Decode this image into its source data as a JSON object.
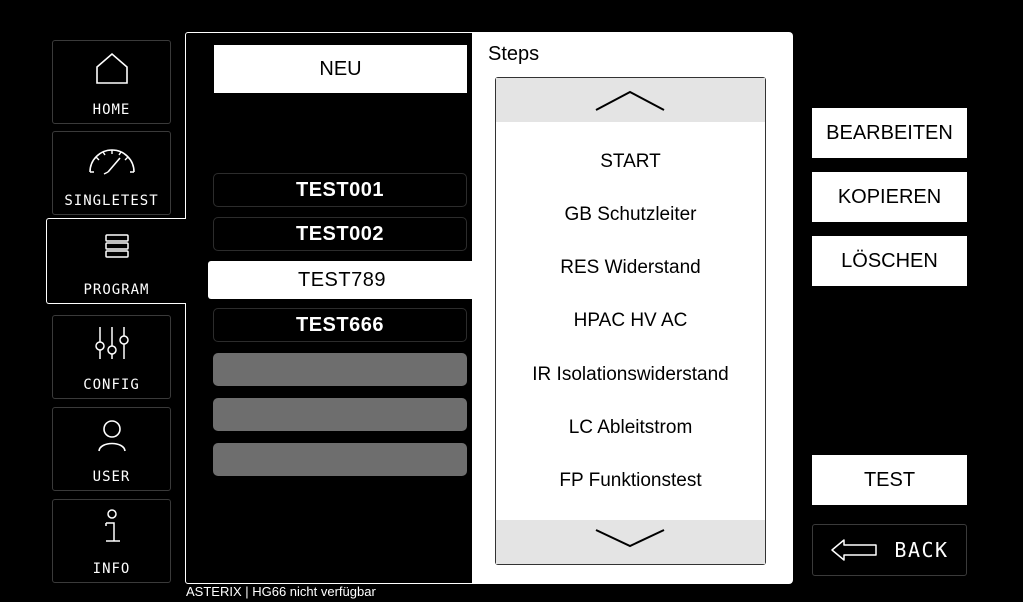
{
  "sidebar": {
    "items": [
      {
        "label": "HOME",
        "icon": "home-icon"
      },
      {
        "label": "SINGLETEST",
        "icon": "gauge-icon"
      },
      {
        "label": "PROGRAM",
        "icon": "stack-icon"
      },
      {
        "label": "CONFIG",
        "icon": "sliders-icon"
      },
      {
        "label": "USER",
        "icon": "user-icon"
      },
      {
        "label": "INFO",
        "icon": "info-icon"
      }
    ],
    "active": "PROGRAM"
  },
  "programs": {
    "new_label": "NEU",
    "items": [
      "TEST001",
      "TEST002",
      "TEST789",
      "TEST666",
      "",
      "",
      ""
    ],
    "selected": "TEST789"
  },
  "steps": {
    "title": "Steps",
    "items": [
      "START",
      "GB Schutzleiter",
      "RES Widerstand",
      "HPAC HV AC",
      "IR Isolationswiderstand",
      "LC Ableitstrom",
      "FP Funktionstest"
    ]
  },
  "actions": {
    "edit": "BEARBEITEN",
    "copy": "KOPIEREN",
    "delete": "LÖSCHEN",
    "test": "TEST",
    "back": "BACK"
  },
  "status": {
    "text": "ASTERIX | HG66 nicht verfügbar"
  },
  "colors": {
    "background": "#000000",
    "panel": "#ffffff",
    "empty_slot": "#6e6e6e",
    "scroll_button": "#e4e4e4"
  }
}
